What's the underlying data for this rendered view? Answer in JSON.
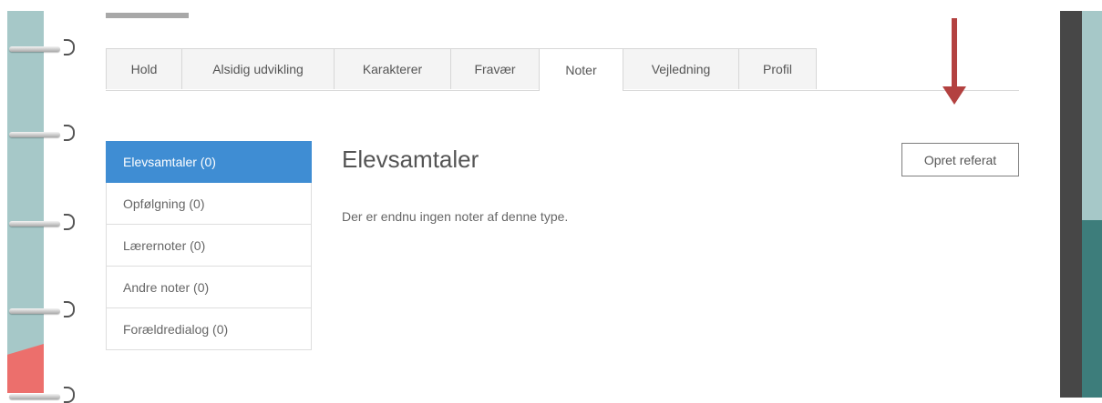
{
  "tabs": [
    {
      "label": "Hold"
    },
    {
      "label": "Alsidig udvikling"
    },
    {
      "label": "Karakterer"
    },
    {
      "label": "Fravær"
    },
    {
      "label": "Noter",
      "active": true
    },
    {
      "label": "Vejledning"
    },
    {
      "label": "Profil"
    }
  ],
  "sidebar": {
    "items": [
      {
        "label": "Elevsamtaler (0)",
        "active": true
      },
      {
        "label": "Opfølgning (0)"
      },
      {
        "label": "Lærernoter (0)"
      },
      {
        "label": "Andre noter (0)"
      },
      {
        "label": "Forældredialog (0)"
      }
    ]
  },
  "main": {
    "heading": "Elevsamtaler",
    "empty_text": "Der er endnu ingen noter af denne type.",
    "create_button_label": "Opret referat"
  },
  "colors": {
    "active_item": "#3f8dd3",
    "annotation_arrow": "#b34140",
    "notebook_strip": "#a6c8c8",
    "notebook_accent": "#ec6f6c",
    "right_teal": "#3d7d7b"
  }
}
